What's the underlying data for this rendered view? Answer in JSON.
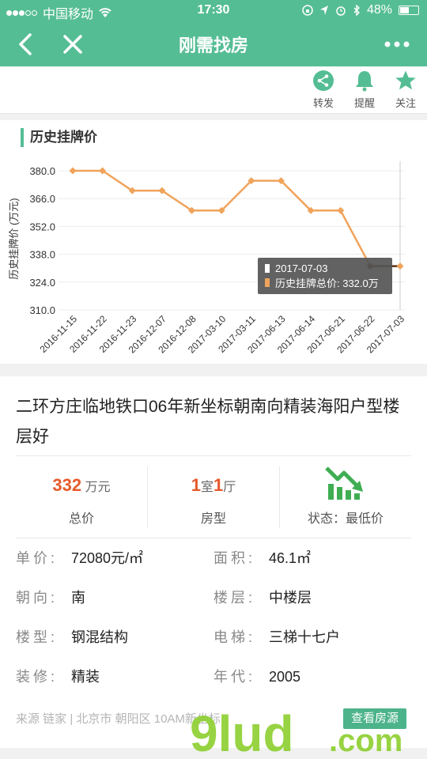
{
  "status_bar": {
    "carrier": "中国移动",
    "time": "17:30",
    "battery": "48%"
  },
  "nav": {
    "title": "刚需找房",
    "back_icon": "chevron-left-icon",
    "close_icon": "close-icon",
    "more_icon": "more-dots-icon"
  },
  "actions": [
    {
      "label": "转发",
      "icon": "share-icon"
    },
    {
      "label": "提醒",
      "icon": "bell-icon"
    },
    {
      "label": "关注",
      "icon": "star-icon"
    }
  ],
  "chart_section": {
    "title": "历史挂牌价"
  },
  "chart_data": {
    "type": "line",
    "ylabel": "历史挂牌价 (万元)",
    "xlabel": "",
    "ylim": [
      310.0,
      380.0
    ],
    "y_ticks": [
      "380.0",
      "366.0",
      "352.0",
      "338.0",
      "324.0",
      "310.0"
    ],
    "categories": [
      "2016-11-15",
      "2016-11-22",
      "2016-11-23",
      "2016-12-07",
      "2016-12-08",
      "2017-03-10",
      "2017-03-11",
      "2017-06-13",
      "2017-06-14",
      "2017-06-21",
      "2017-06-22",
      "2017-07-03"
    ],
    "series": [
      {
        "name": "历史挂牌总价",
        "values": [
          380,
          380,
          370,
          370,
          360,
          360,
          375,
          375,
          360,
          360,
          332,
          332
        ]
      }
    ],
    "line_color": "#f0a35a",
    "tooltip": {
      "date": "2017-07-03",
      "text": "历史挂牌总价: 332.0万"
    }
  },
  "listing": {
    "title": "二环方庄临地铁口06年新坐标朝南向精装海阳户型楼层好",
    "price_value": "332",
    "price_unit": "万元",
    "price_label": "总价",
    "room_count": "1",
    "room_unit": "室",
    "hall_count": "1",
    "hall_unit": "厅",
    "layout_label": "房型",
    "status_label": "状态：最低价",
    "status_icon": "price-down-chart-icon",
    "accent_color": "#e65a2c",
    "details": [
      {
        "key": "单价:",
        "value": "72080元/㎡"
      },
      {
        "key": "面积:",
        "value": "46.1㎡"
      },
      {
        "key": "朝向:",
        "value": "南"
      },
      {
        "key": "楼层:",
        "value": "中楼层"
      },
      {
        "key": "楼型:",
        "value": "钢混结构"
      },
      {
        "key": "电梯:",
        "value": "三梯十七户"
      },
      {
        "key": "装修:",
        "value": "精装"
      },
      {
        "key": "年代:",
        "value": "2005"
      }
    ],
    "source_text": "来源 链家 | 北京市 朝阳区 10AM新坐标",
    "source_button": "查看房源"
  },
  "watermark": "9lud.com"
}
